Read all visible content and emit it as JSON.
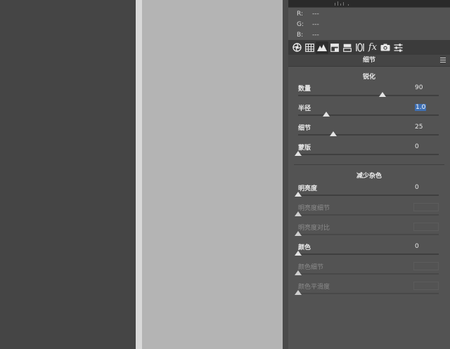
{
  "histogram_readout": {
    "r_label": "R:",
    "r_value": "---",
    "g_label": "G:",
    "g_value": "---",
    "b_label": "B:",
    "b_value": "---"
  },
  "panel": {
    "title": "细节"
  },
  "toolbar": {
    "tools": [
      "aperture-icon",
      "grid-icon",
      "mountains-icon",
      "hsl-icon",
      "split-tone-icon",
      "lens-icon",
      "fx-icon",
      "camera-icon",
      "sliders-icon"
    ],
    "fx_label": "fx",
    "active": "mountains-icon"
  },
  "sharpening": {
    "title": "锐化",
    "amount": {
      "label": "数量",
      "value": "90",
      "level": 90,
      "min": 0,
      "max": 150
    },
    "radius": {
      "label": "半径",
      "value": "1.0",
      "level": 1.0,
      "min": 0.5,
      "max": 3.0
    },
    "detail": {
      "label": "细节",
      "value": "25",
      "level": 25,
      "min": 0,
      "max": 100
    },
    "masking": {
      "label": "蒙版",
      "value": "0",
      "level": 0,
      "min": 0,
      "max": 100
    }
  },
  "noise_reduction": {
    "title": "减少杂色",
    "luminance": {
      "label": "明亮度",
      "value": "0",
      "level": 0,
      "enabled": true
    },
    "luminance_detail": {
      "label": "明亮度细节",
      "value": "",
      "level": 0,
      "enabled": false
    },
    "luminance_contrast": {
      "label": "明亮度对比",
      "value": "",
      "level": 0,
      "enabled": false
    },
    "color": {
      "label": "颜色",
      "value": "0",
      "level": 0,
      "enabled": true
    },
    "color_detail": {
      "label": "颜色细节",
      "value": "",
      "level": 0,
      "enabled": false
    },
    "color_smoothness": {
      "label": "颜色平滑度",
      "value": "",
      "level": 0,
      "enabled": false
    }
  },
  "colors": {
    "selection": "#3e6fb3",
    "panel_bg": "#535353",
    "canvas_bg": "#b4b4b4"
  }
}
